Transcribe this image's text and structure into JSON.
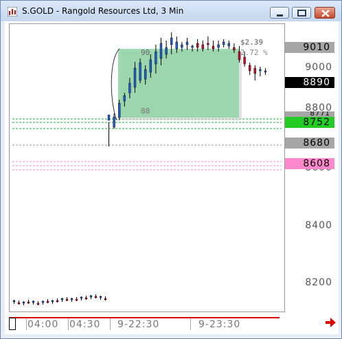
{
  "window": {
    "title": "S.GOLD - Rangold Resources Ltd, 3 Min",
    "minimize_icon": "minimize-icon",
    "maximize_icon": "maximize-icon",
    "close_icon": "close-icon",
    "close_color": "#c5482b"
  },
  "price_axis": {
    "ticks": [
      "9000",
      "8800",
      "8600",
      "8400",
      "8200"
    ],
    "tags": [
      {
        "label": "9010",
        "color": "#a6a6a6",
        "text_color": "#000000"
      },
      {
        "label": "8890",
        "color": "#000000",
        "text_color": "#ffffff"
      },
      {
        "label": "8771",
        "color": "#a6a6a6",
        "text_color": "#000000"
      },
      {
        "label": "8752",
        "color": "#22cc22",
        "text_color": "#000000"
      },
      {
        "label": "8680",
        "color": "#a6a6a6",
        "text_color": "#000000"
      },
      {
        "label": "8608",
        "color": "#ff88cc",
        "text_color": "#000000"
      }
    ]
  },
  "measurement": {
    "change": "$2.39",
    "percent": "2.72 %",
    "start_label": "88",
    "end_label": "90",
    "fill_color": "#8fd4a4"
  },
  "time_axis": {
    "labels": [
      "04:00",
      "04:30",
      "9-22:30",
      "9-23:30"
    ]
  },
  "scroll_arrow": "right-arrow-icon",
  "colors": {
    "green_line": "#22aa44",
    "pink_line": "#ff88cc",
    "gray_line": "#999999",
    "scrollbar_red": "#dd0000"
  }
}
